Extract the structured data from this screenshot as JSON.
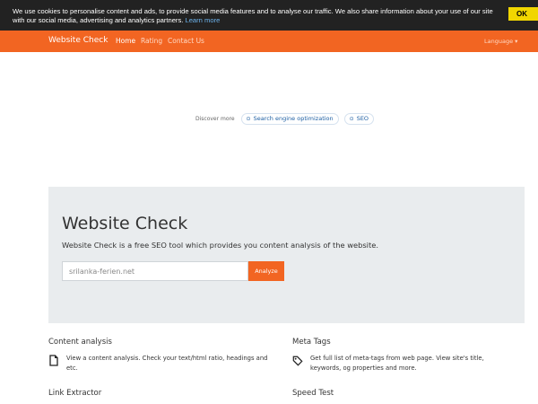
{
  "cookie": {
    "text": "We use cookies to personalise content and ads, to provide social media features and to analyse our traffic. We also share information about your use of our site with our social media, advertising and analytics partners.",
    "learn_more": "Learn more",
    "ok_label": "OK"
  },
  "nav": {
    "brand": "Website Check",
    "links": [
      {
        "label": "Home",
        "active": true
      },
      {
        "label": "Rating",
        "active": false
      },
      {
        "label": "Contact Us",
        "active": false
      }
    ],
    "language": "Language ▾"
  },
  "discover": {
    "label": "Discover more",
    "chips": [
      "Search engine optimization",
      "SEO"
    ]
  },
  "hero": {
    "title": "Website Check",
    "subtitle": "Website Check is a free SEO tool which provides you content analysis of the website.",
    "input_value": "srilanka-ferien.net",
    "analyze_label": "Analyze"
  },
  "features": [
    {
      "title": "Content analysis",
      "icon": "document-icon",
      "desc": "View a content analysis. Check your text/html ratio, headings and etc."
    },
    {
      "title": "Meta Tags",
      "icon": "tag-icon",
      "desc": "Get full list of meta-tags from web page. View site's title, keywords, og properties and more."
    },
    {
      "title": "Link Extractor",
      "icon": "link-icon",
      "desc": ""
    },
    {
      "title": "Speed Test",
      "icon": "speed-icon",
      "desc": ""
    }
  ],
  "colors": {
    "brand": "#f26522",
    "cookie_bg": "#222222",
    "cookie_button": "#f1d600",
    "hero_bg": "#e9ecee",
    "link": "#1d5fa3"
  }
}
